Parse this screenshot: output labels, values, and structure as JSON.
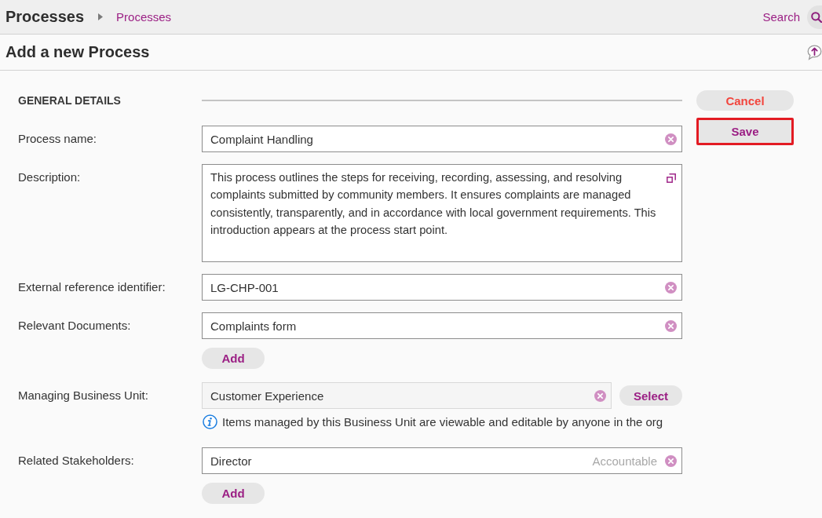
{
  "header": {
    "title": "Processes",
    "breadcrumb": [
      {
        "label": "Processes"
      }
    ],
    "search": {
      "label": "Search"
    }
  },
  "page": {
    "title": "Add a new Process"
  },
  "form": {
    "section_title": "GENERAL DETAILS",
    "fields": [
      {
        "kind": "text",
        "label": "Process name:",
        "value": "Complaint Handling"
      },
      {
        "kind": "textarea",
        "label": "Description:",
        "value": "This process outlines the steps for receiving, recording, assessing, and resolving complaints submitted by community members. It ensures complaints are managed consistently, transparently, and in accordance with local government requirements. This introduction appears at the process start point."
      },
      {
        "kind": "text",
        "label": "External reference identifier:",
        "value": "LG-CHP-001"
      },
      {
        "kind": "list",
        "label": "Relevant Documents:",
        "items": [
          {
            "value": "Complaints form"
          }
        ],
        "add_button": "Add"
      },
      {
        "kind": "picker",
        "label": "Managing Business Unit:",
        "value": "Customer Experience",
        "button": "Select",
        "info": "Items managed by this Business Unit are viewable and editable by anyone in the org"
      },
      {
        "kind": "list",
        "label": "Related Stakeholders:",
        "items": [
          {
            "value": "Director",
            "role": "Accountable"
          }
        ],
        "add_button": "Add"
      }
    ]
  },
  "actions": [
    {
      "kind": "cancel",
      "label": "Cancel",
      "highlighted": false
    },
    {
      "kind": "save",
      "label": "Save",
      "highlighted": true
    }
  ]
}
